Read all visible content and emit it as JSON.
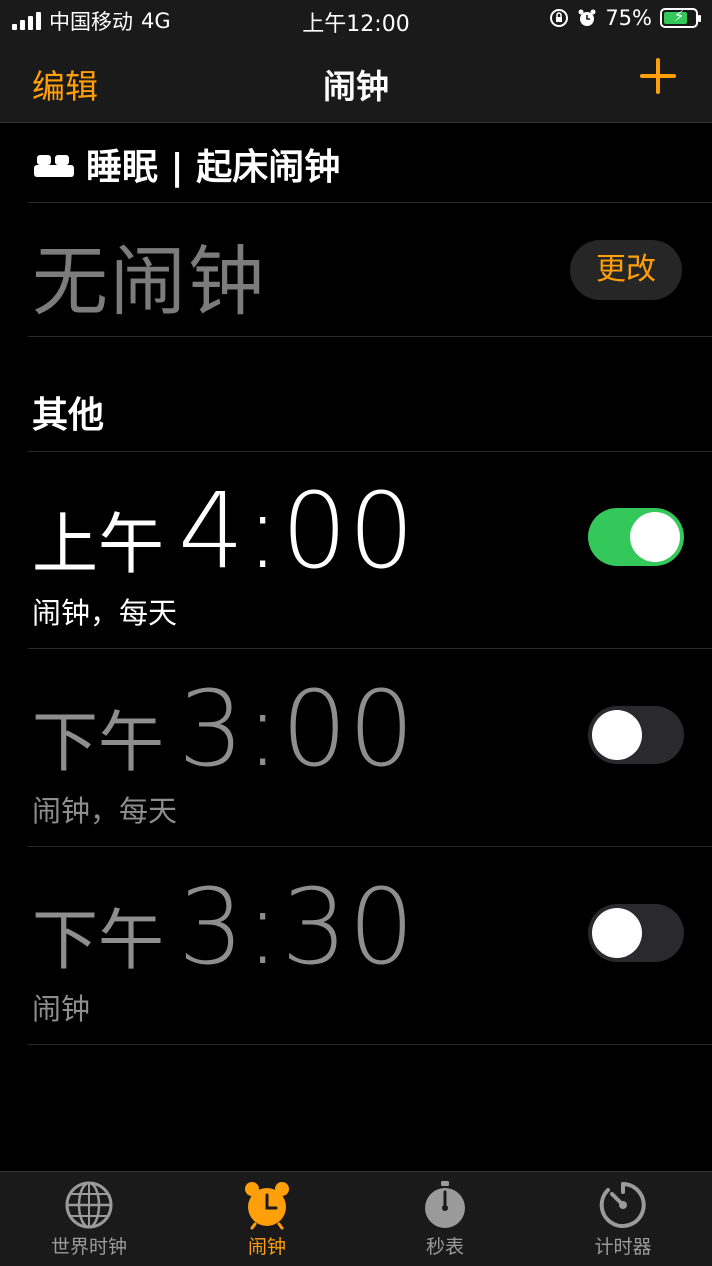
{
  "status_bar": {
    "carrier": "中国移动",
    "network": "4G",
    "time": "上午12:00",
    "battery_percent": "75%",
    "battery_level": 0.75,
    "battery_color": "#34c759"
  },
  "nav": {
    "edit_label": "编辑",
    "title": "闹钟",
    "add_icon": "plus-icon"
  },
  "sleep": {
    "header": "睡眠 | 起床闹钟",
    "no_alarm": "无闹钟",
    "change_label": "更改"
  },
  "other_header": "其他",
  "alarms": [
    {
      "period": "上午",
      "time": "4:00",
      "label": "闹钟，每天",
      "enabled": true
    },
    {
      "period": "下午",
      "time": "3:00",
      "label": "闹钟，每天",
      "enabled": false
    },
    {
      "period": "下午",
      "time": "3:30",
      "label": "闹钟",
      "enabled": false
    }
  ],
  "tabs": [
    {
      "label": "世界时钟",
      "icon": "globe-icon",
      "active": false
    },
    {
      "label": "闹钟",
      "icon": "alarm-clock-icon",
      "active": true
    },
    {
      "label": "秒表",
      "icon": "stopwatch-icon",
      "active": false
    },
    {
      "label": "计时器",
      "icon": "timer-icon",
      "active": false
    }
  ],
  "colors": {
    "accent": "#ff9f0a",
    "toggle_on": "#34c759",
    "inactive_text": "#8e8e8e"
  }
}
